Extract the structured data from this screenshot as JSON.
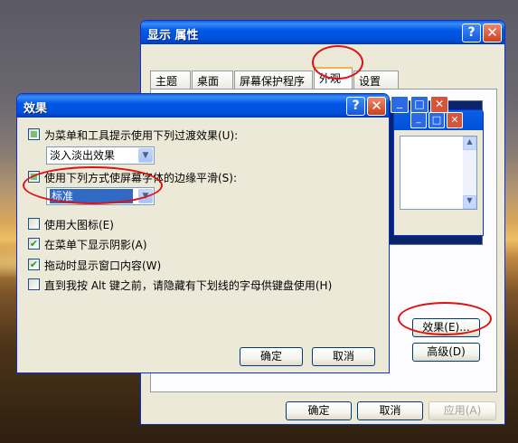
{
  "display_properties": {
    "title": "显示 属性",
    "tabs": [
      "主题",
      "桌面",
      "屏幕保护程序",
      "外观",
      "设置"
    ],
    "active_tab": "外观",
    "effects_button": "效果(E)...",
    "advanced_button": "高级(D)",
    "ok_button": "确定",
    "cancel_button": "取消",
    "apply_button": "应用(A)"
  },
  "effects_dialog": {
    "title": "效果",
    "options": [
      {
        "label": "为菜单和工具提示使用下列过渡效果(U):",
        "checked": "partial"
      },
      {
        "label": "使用下列方式使屏幕字体的边缘平滑(S):",
        "checked": "partial"
      },
      {
        "label": "使用大图标(E)",
        "checked": false
      },
      {
        "label": "在菜单下显示阴影(A)",
        "checked": true
      },
      {
        "label": "拖动时显示窗口内容(W)",
        "checked": true
      },
      {
        "label": "直到我按 Alt 键之前，请隐藏有下划线的字母供键盘使用(H)",
        "checked": false
      }
    ],
    "transition_value": "淡入淡出效果",
    "smoothing_value": "标准",
    "ok_button": "确定",
    "cancel_button": "取消"
  },
  "colors": {
    "titlebar": "#0058e6",
    "window_bg": "#ece9d8",
    "annotation": "#e01010"
  }
}
